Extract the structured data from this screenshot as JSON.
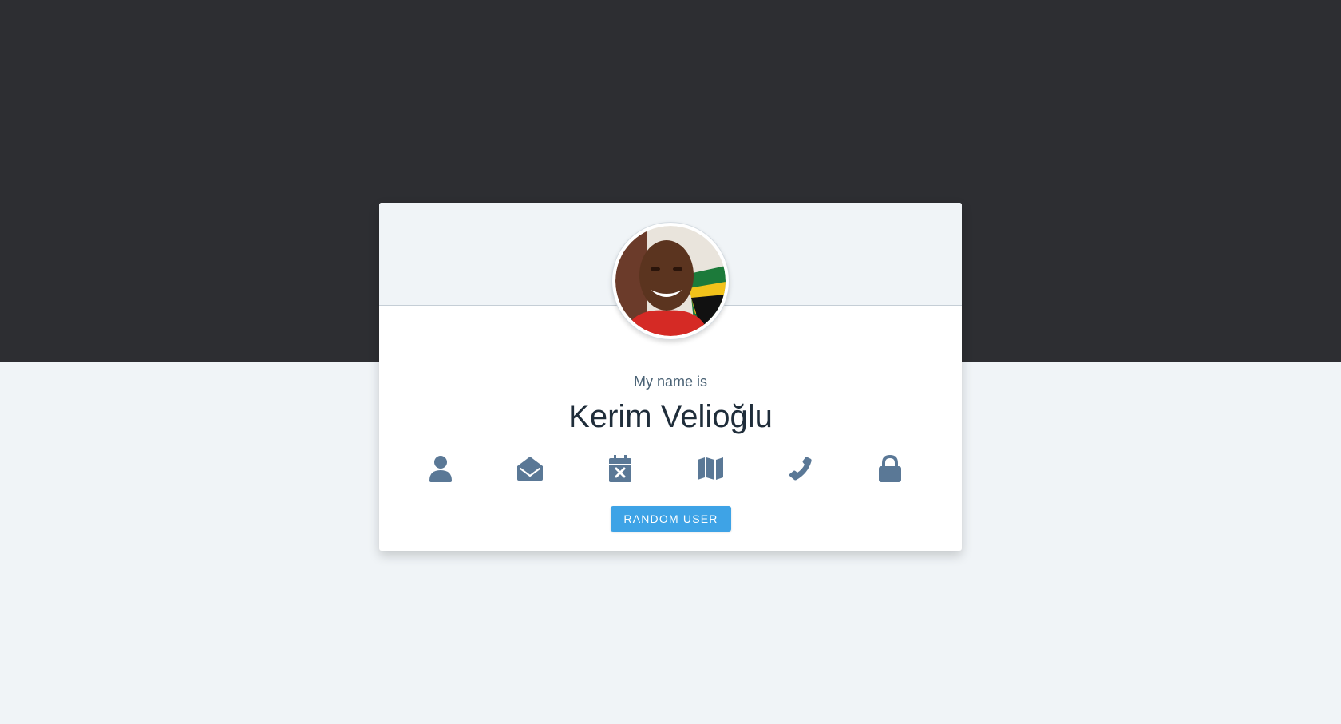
{
  "card": {
    "label": "My name is",
    "value": "Kerim Velioğlu"
  },
  "icons": [
    {
      "name": "user-icon"
    },
    {
      "name": "envelope-open-icon"
    },
    {
      "name": "calendar-x-icon"
    },
    {
      "name": "map-icon"
    },
    {
      "name": "phone-icon"
    },
    {
      "name": "lock-icon"
    }
  ],
  "button": {
    "label": "RANDOM USER"
  },
  "colors": {
    "dark_band": "#2d2e32",
    "page_bg": "#f0f4f7",
    "icon": "#5a7896",
    "button": "#3ea3e6",
    "name_text": "#1f2d3a"
  }
}
